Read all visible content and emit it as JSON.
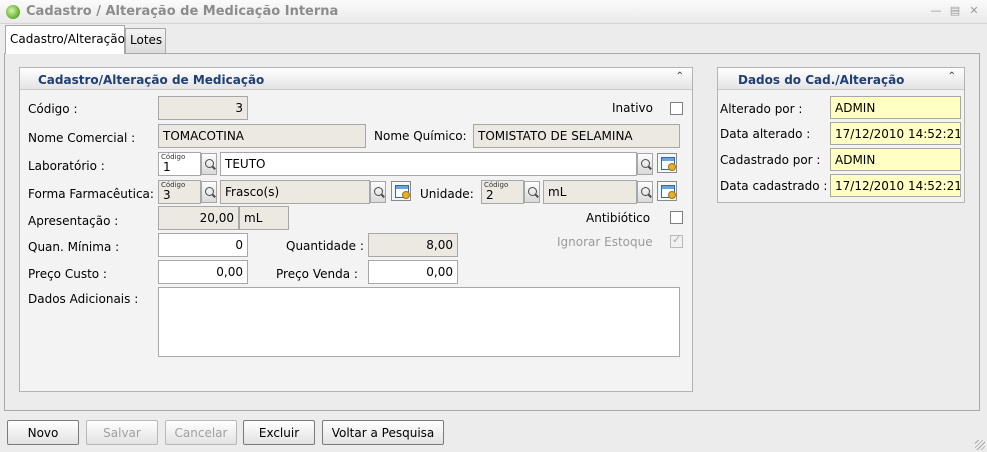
{
  "window": {
    "title": "Cadastro / Alteração de Medicação Interna",
    "minimize_icon": "minimize-icon",
    "restore_icon": "restore-icon",
    "close_icon": "close-icon"
  },
  "tabs": [
    {
      "label": "Cadastro/Alteração",
      "active": true
    },
    {
      "label": "Lotes",
      "active": false
    }
  ],
  "form": {
    "panel_title": "Cadastro/Alteração de Medicação",
    "codigo_label": "Código :",
    "codigo_value": "3",
    "inativo_label": "Inativo",
    "inativo_checked": false,
    "nome_comercial_label": "Nome Comercial :",
    "nome_comercial_value": "TOMACOTINA",
    "nome_quimico_label": "Nome Químico:",
    "nome_quimico_value": "TOMISTATO DE SELAMINA",
    "laboratorio_label": "Laboratório :",
    "code_caption": "Código",
    "laboratorio_code": "1",
    "laboratorio_value": "TEUTO",
    "forma_label": "Forma Farmacêutica:",
    "forma_code": "3",
    "forma_value": "Frasco(s)",
    "unidade_label": "Unidade:",
    "unidade_code": "2",
    "unidade_value": "mL",
    "apresentacao_label": "Apresentação :",
    "apresentacao_value": "20,00",
    "apresentacao_unit": "mL",
    "antibiotico_label": "Antibiótico",
    "antibiotico_checked": false,
    "quan_minima_label": "Quan. Mínima :",
    "quan_minima_value": "0",
    "quantidade_label": "Quantidade :",
    "quantidade_value": "8,00",
    "ignorar_estoque_label": "Ignorar Estoque",
    "ignorar_estoque_checked": true,
    "preco_custo_label": "Preço Custo :",
    "preco_custo_value": "0,00",
    "preco_venda_label": "Preço Venda :",
    "preco_venda_value": "0,00",
    "dados_adicionais_label": "Dados Adicionais :",
    "dados_adicionais_value": ""
  },
  "audit": {
    "panel_title": "Dados do Cad./Alteração",
    "alterado_por_label": "Alterado por :",
    "alterado_por_value": "ADMIN",
    "data_alterado_label": "Data alterado :",
    "data_alterado_value": "17/12/2010 14:52:21",
    "cadastrado_por_label": "Cadastrado por :",
    "cadastrado_por_value": "ADMIN",
    "data_cadastrado_label": "Data cadastrado :",
    "data_cadastrado_value": "17/12/2010 14:52:21"
  },
  "buttons": {
    "novo": {
      "label": "Novo",
      "enabled": true
    },
    "salvar": {
      "label": "Salvar",
      "enabled": false
    },
    "cancelar": {
      "label": "Cancelar",
      "enabled": false
    },
    "excluir": {
      "label": "Excluir",
      "enabled": true
    },
    "voltar": {
      "label": "Voltar a Pesquisa",
      "enabled": true
    }
  }
}
